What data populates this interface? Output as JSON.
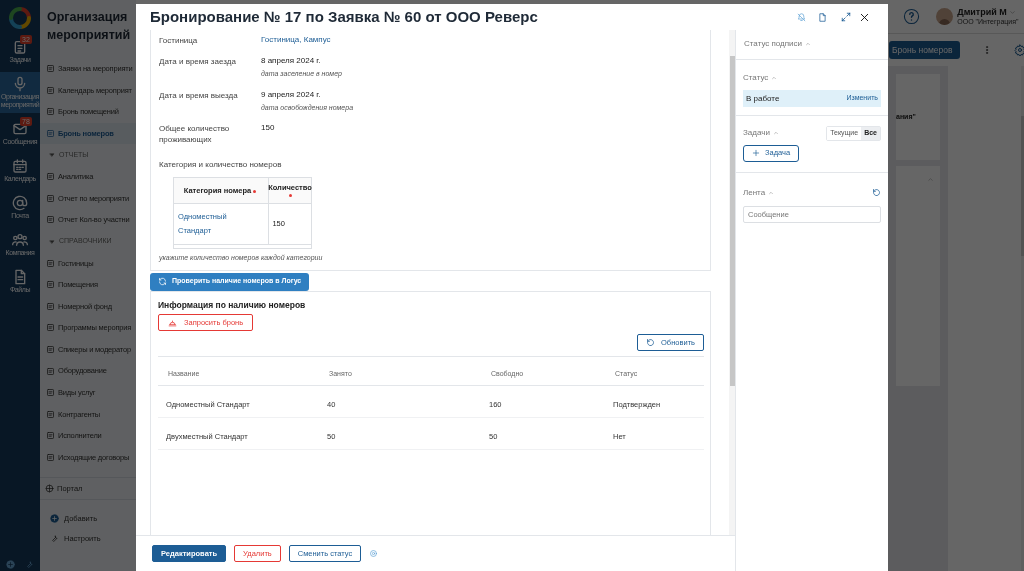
{
  "rail": {
    "items": [
      {
        "label": "Задачи",
        "badge": "32",
        "selected": false
      },
      {
        "label": "Организация мероприятий",
        "selected": true
      },
      {
        "label": "Сообщения",
        "badge": "78",
        "selected": false
      },
      {
        "label": "Календарь",
        "selected": false
      },
      {
        "label": "Почта",
        "selected": false
      },
      {
        "label": "Компания",
        "selected": false
      },
      {
        "label": "Файлы",
        "selected": false
      }
    ]
  },
  "app_sidebar": {
    "title": "Организация мероприятий",
    "items": [
      {
        "kind": "link",
        "label": "Заявки на мероприяти",
        "selected": false
      },
      {
        "kind": "link",
        "label": "Календарь мероприят",
        "selected": false
      },
      {
        "kind": "link",
        "label": "Бронь помещений",
        "selected": false
      },
      {
        "kind": "link",
        "label": "Бронь номеров",
        "selected": true
      },
      {
        "kind": "section",
        "label": "ОТЧЕТЫ"
      },
      {
        "kind": "link",
        "label": "Аналитика",
        "selected": false
      },
      {
        "kind": "link",
        "label": "Отчет по мероприяти",
        "selected": false
      },
      {
        "kind": "link",
        "label": "Отчет Кол-во участни",
        "selected": false
      },
      {
        "kind": "section",
        "label": "СПРАВОЧНИКИ"
      },
      {
        "kind": "link",
        "label": "Гостиницы",
        "selected": false
      },
      {
        "kind": "link",
        "label": "Помещения",
        "selected": false
      },
      {
        "kind": "link",
        "label": "Номерной фонд",
        "selected": false
      },
      {
        "kind": "link",
        "label": "Программы мероприя",
        "selected": false
      },
      {
        "kind": "link",
        "label": "Спикеры и модератор",
        "selected": false
      },
      {
        "kind": "link",
        "label": "Оборудование",
        "selected": false
      },
      {
        "kind": "link",
        "label": "Виды услуг",
        "selected": false
      },
      {
        "kind": "link",
        "label": "Контрагенты",
        "selected": false
      },
      {
        "kind": "link",
        "label": "Исполнители",
        "selected": false
      },
      {
        "kind": "link",
        "label": "Исходящие договоры",
        "selected": false
      }
    ],
    "portal": "Портал",
    "actions": [
      "Добавить",
      "Настроить"
    ]
  },
  "header": {
    "user_name": "Дмитрий М",
    "user_company": "ООО \"Интеграция\""
  },
  "toolbar": {
    "button": "Бронь номеров"
  },
  "background_card": {
    "text": "ания\""
  },
  "modal": {
    "title": "Бронирование № 17 по Заявка № 60 от ООО Реверс",
    "fields": [
      {
        "label": "Гостиница",
        "value": "Гостиница, Кампус",
        "kind": "link"
      },
      {
        "label": "Дата и время заезда",
        "value": "8 апреля 2024 г.",
        "hint": "дата заселение в номер",
        "kind": "text"
      },
      {
        "label": "Дата и время выезда",
        "value": "9 апреля 2024 г.",
        "hint": "дата освобождения номера",
        "kind": "text"
      },
      {
        "label": "Общее количество проживающих",
        "value": "150",
        "kind": "text"
      }
    ],
    "rooms_table": {
      "label": "Категория и количество номеров",
      "columns": [
        {
          "label": "Категория номера",
          "required": true
        },
        {
          "label": "Количество",
          "required": true
        }
      ],
      "rows": [
        [
          "Одноместный Стандарт",
          "150"
        ]
      ],
      "hint": "укажите количество номеров каждой категории"
    },
    "check_button": "Проверить наличие номеров в Логус",
    "availability": {
      "title": "Информация по наличию номеров",
      "request_button": "Запросить бронь",
      "refresh_button": "Обновить",
      "columns": [
        "Название",
        "Занято",
        "Свободно",
        "Статус"
      ],
      "rows": [
        [
          "Одноместный Стандарт",
          "40",
          "160",
          "Подтвержден"
        ],
        [
          "Двухместный Стандарт",
          "50",
          "50",
          "Нет"
        ]
      ]
    },
    "footer_buttons": [
      {
        "label": "Редактировать",
        "kind": "primary"
      },
      {
        "label": "Удалить",
        "kind": "danger"
      },
      {
        "label": "Сменить статус",
        "kind": "outline"
      }
    ],
    "side": {
      "signature_title": "Статус подписи",
      "status_title": "Статус",
      "status_value": "В работе",
      "status_action": "Изменить",
      "tasks_title": "Задачи",
      "task_filters": [
        {
          "label": "Текущие",
          "selected": false
        },
        {
          "label": "Все",
          "selected": true
        }
      ],
      "task_button": "Задача",
      "feed_title": "Лента",
      "message_placeholder": "Сообщение"
    }
  }
}
